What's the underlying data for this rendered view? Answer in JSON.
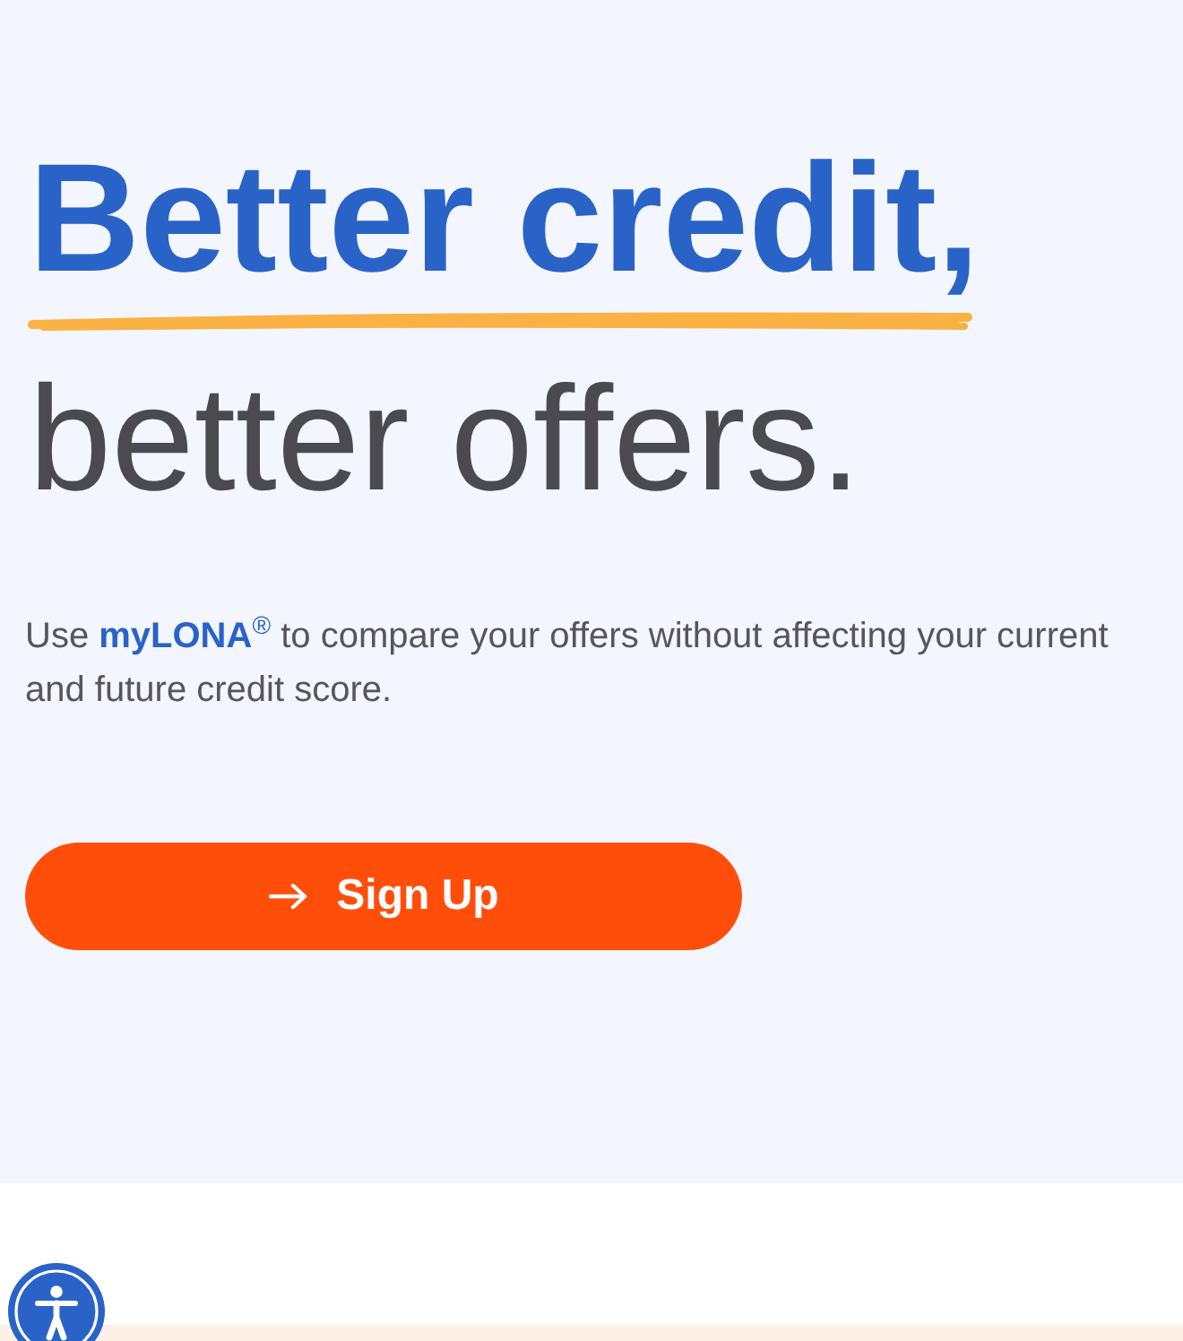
{
  "hero": {
    "headline": {
      "line_1": "Better credit,",
      "line_2": "better offers."
    },
    "description": "Use **myLONA**$^{®}$ to compare your offers without affecting your current and future credit score.",
    "cta_button": {
      "label": "Sign Up"
    }
  }
}
